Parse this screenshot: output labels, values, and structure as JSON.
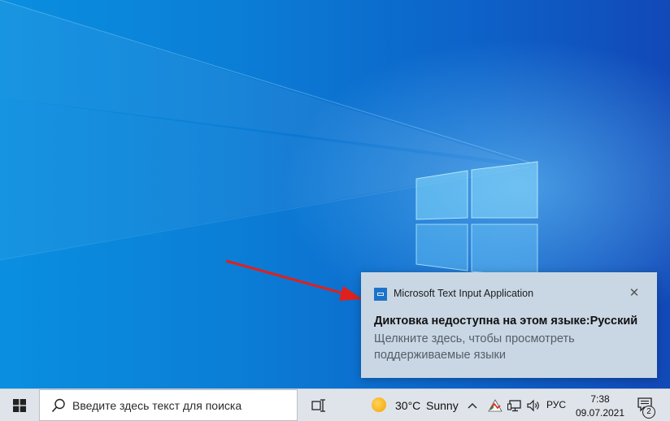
{
  "notification": {
    "app_name": "Microsoft Text Input Application",
    "app_icon": "keyboard-icon",
    "close_glyph": "✕",
    "title": "Диктовка недоступна на этом языке:Русский",
    "body": "Щелкните здесь, чтобы просмотреть поддерживаемые языки"
  },
  "taskbar": {
    "start_icon": "windows-logo-icon",
    "search": {
      "placeholder": "Введите здесь текст для поиска",
      "icon": "search-icon"
    },
    "task_view_icon": "task-view-icon",
    "weather": {
      "temperature": "30°C",
      "condition": "Sunny",
      "icon": "sun-icon"
    },
    "tray": {
      "chevron": "^",
      "language": "РУС",
      "icons": [
        "show-hidden-icons-chevron",
        "security-warning-icon",
        "network-icon",
        "volume-icon"
      ]
    },
    "clock": {
      "time": "7:38",
      "date": "09.07.2021"
    },
    "notifications_count": "2"
  },
  "colors": {
    "accent": "#1c74c9",
    "arrow": "#e0201c",
    "taskbar": "#dfe4ea",
    "toast": "#c9d7e4"
  }
}
